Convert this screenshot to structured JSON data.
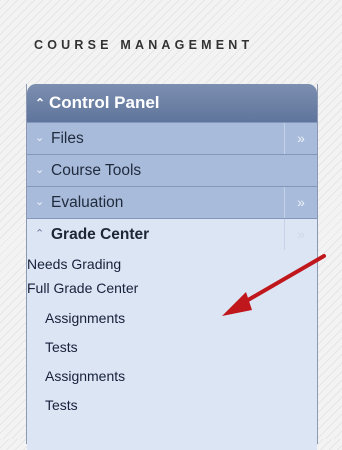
{
  "section_title": "COURSE MANAGEMENT",
  "control_panel": {
    "label": "Control Panel",
    "icon": "double-chevron-up-icon"
  },
  "menu": [
    {
      "label": "Files",
      "chevron": "double-chevron-down-icon",
      "has_expand": true
    },
    {
      "label": "Course Tools",
      "chevron": "double-chevron-down-icon",
      "has_expand": false
    },
    {
      "label": "Evaluation",
      "chevron": "double-chevron-down-icon",
      "has_expand": true
    },
    {
      "label": "Grade Center",
      "chevron": "double-chevron-up-icon",
      "has_expand": true,
      "active": true
    }
  ],
  "grade_center_links": [
    "Needs Grading",
    "Full Grade Center"
  ],
  "smart_views": [
    "Assignments",
    "Tests",
    "Assignments",
    "Tests"
  ],
  "colors": {
    "header": "#6b7fa5",
    "row": "#a9bbda",
    "active_row": "#dce5f4",
    "arrow": "#c0171d"
  }
}
